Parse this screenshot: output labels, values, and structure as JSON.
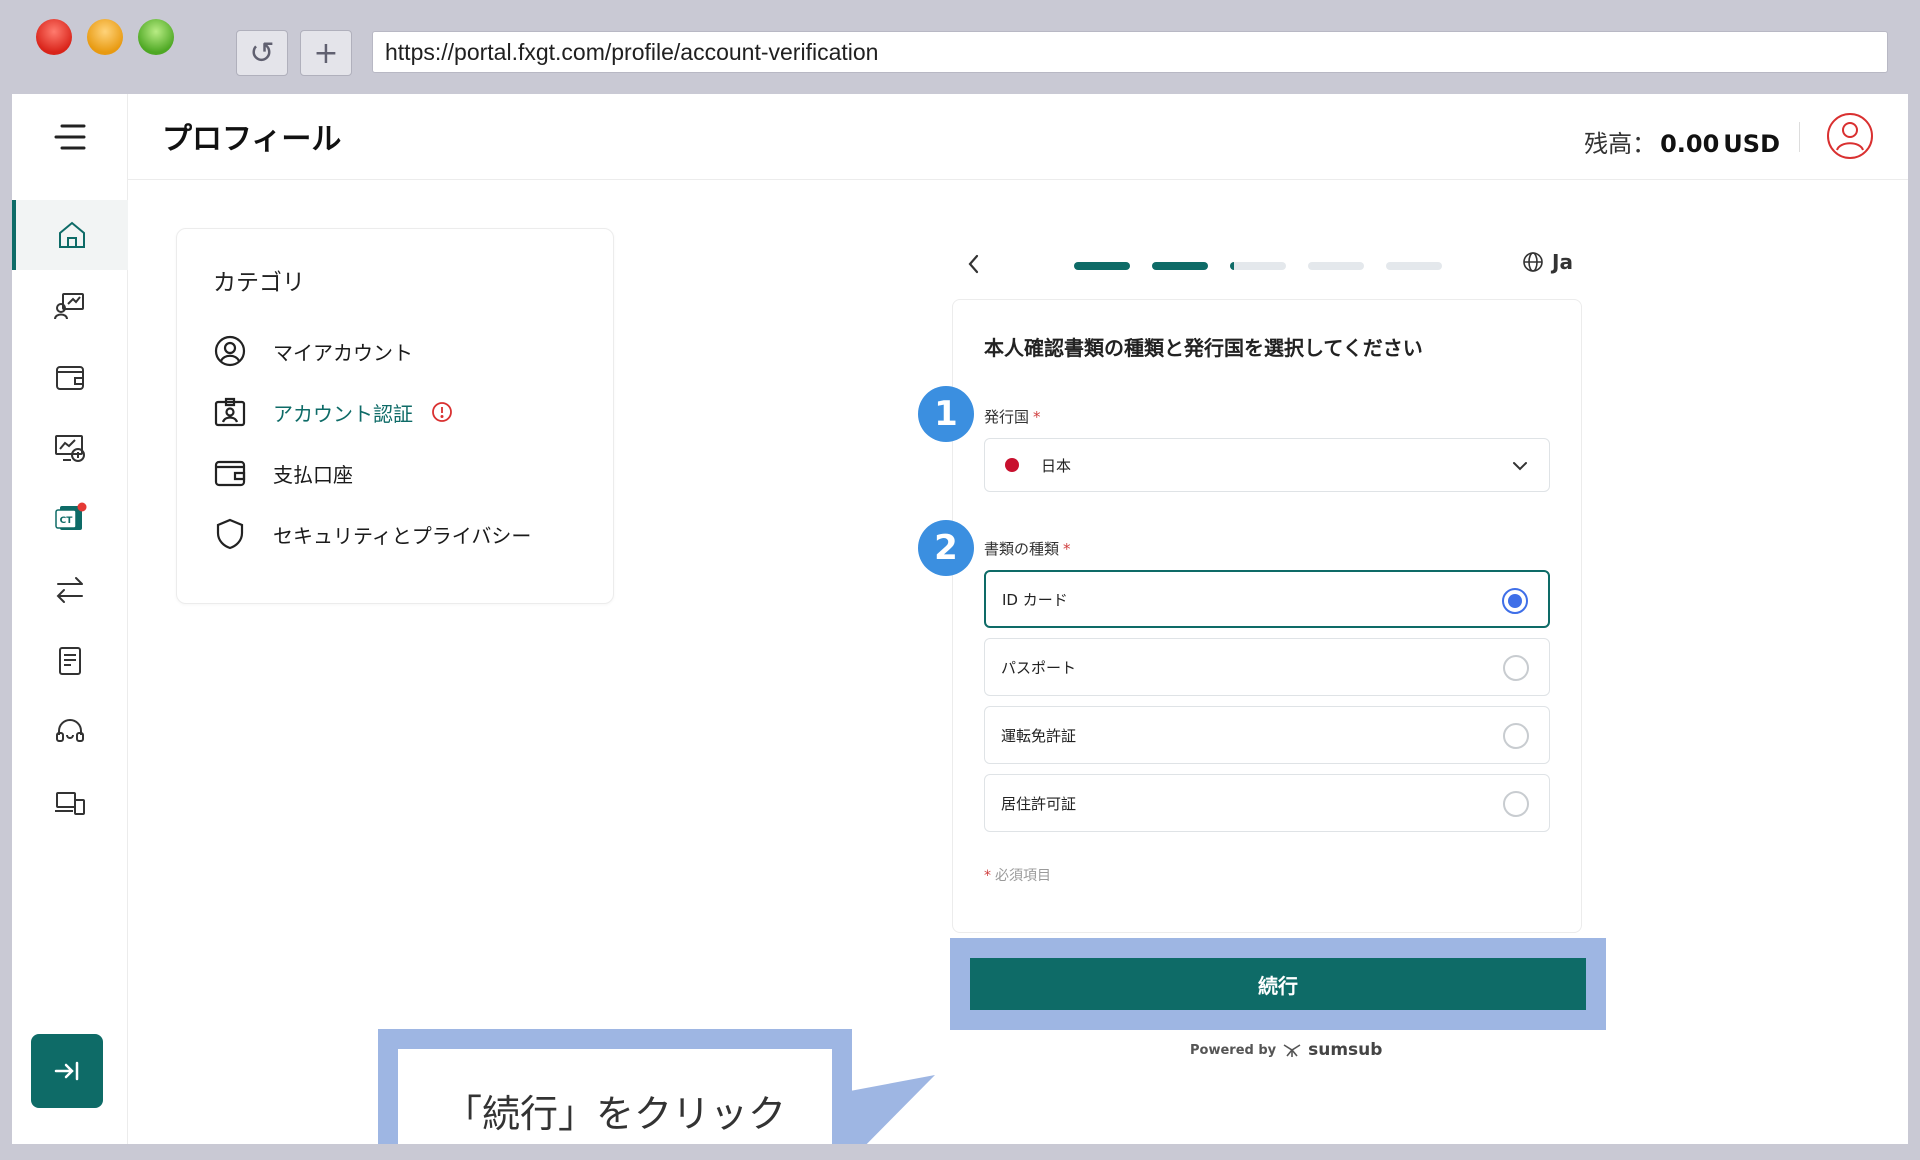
{
  "browser": {
    "url": "https://portal.fxgt.com/profile/account-verification",
    "reload_glyph": "↺",
    "newtab_glyph": "+"
  },
  "header": {
    "title": "プロフィール",
    "balance_label": "残高：",
    "balance_amount": "0.00",
    "balance_currency": "USD"
  },
  "sidebar": {
    "items": [
      {
        "icon": "home-icon",
        "active": true
      },
      {
        "icon": "trade-account-icon"
      },
      {
        "icon": "wallet-icon"
      },
      {
        "icon": "investment-icon"
      },
      {
        "icon": "ct-icon",
        "badge": "CT"
      },
      {
        "icon": "transfer-icon"
      },
      {
        "icon": "document-icon"
      },
      {
        "icon": "support-icon"
      },
      {
        "icon": "devices-icon"
      }
    ],
    "collapse_icon": "collapse-icon"
  },
  "category": {
    "title": "カテゴリ",
    "items": [
      {
        "label": "マイアカウント",
        "icon": "user-circle-icon"
      },
      {
        "label": "アカウント認証",
        "icon": "id-badge-icon",
        "active": true,
        "warning": true
      },
      {
        "label": "支払口座",
        "icon": "wallet-icon"
      },
      {
        "label": "セキュリティとプライバシー",
        "icon": "shield-icon"
      }
    ]
  },
  "progress": {
    "steps": [
      1,
      1,
      0.08,
      0,
      0
    ]
  },
  "lang": "Ja",
  "form": {
    "title": "本人確認書類の種類と発行国を選択してください",
    "country_label": "発行国",
    "country_value": "日本",
    "doctype_label": "書類の種類",
    "options": [
      "ID カード",
      "パスポート",
      "運転免許証",
      "居住許可証"
    ],
    "selected_index": 0,
    "required_star": "*",
    "required_note": "必須項目"
  },
  "steps": {
    "one": "1",
    "two": "2"
  },
  "cta": {
    "label": "続行",
    "powered_by": "Powered by",
    "brand": "sumsub"
  },
  "callout": "「続行」をクリック",
  "colors": {
    "brand": "#0e6b67",
    "radio": "#3f6fe8",
    "step_badge": "#3b8fe0",
    "highlight": "#9eb6e3",
    "warning": "#d93030"
  }
}
